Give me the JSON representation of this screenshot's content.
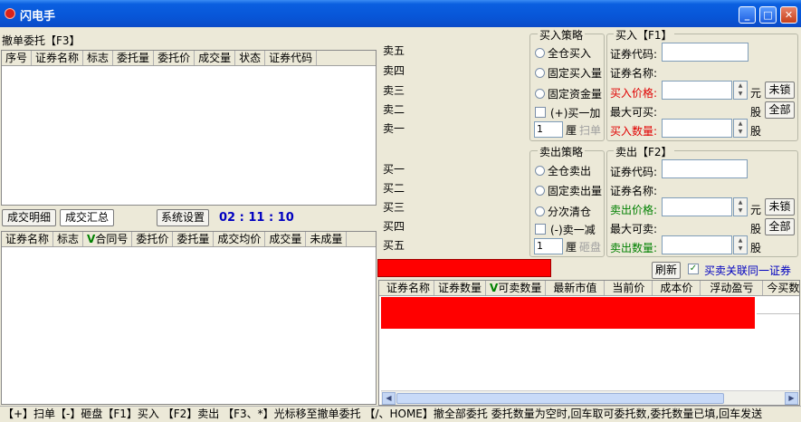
{
  "window": {
    "title": "闪电手"
  },
  "cancel_panel": {
    "title": "撤单委托【F3】",
    "columns": [
      "序号",
      "证券名称",
      "标志",
      "委托量",
      "委托价",
      "成交量",
      "状态",
      "证券代码"
    ]
  },
  "tabs": {
    "detail": "成交明细",
    "summary": "成交汇总"
  },
  "settings_button": "系统设置",
  "timer": "02 : 11 : 10",
  "fills_panel": {
    "columns_prefix": "证券名称",
    "col_flag": "标志",
    "col_contract_mark": "V",
    "col_contract": "合同号",
    "col_price": "委托价",
    "col_qty": "委托量",
    "col_avg": "成交均价",
    "col_filled": "成交量",
    "col_unfilled": "未成量"
  },
  "order_book": {
    "asks": [
      "卖五",
      "卖四",
      "卖三",
      "卖二",
      "卖一"
    ],
    "bids": [
      "买一",
      "买二",
      "买三",
      "买四",
      "买五"
    ]
  },
  "buy_strategy": {
    "title": "买入策略",
    "options": [
      "全仓买入",
      "固定买入量",
      "固定资金量"
    ],
    "add_label": "(+)买一加",
    "tick_value": "1",
    "tick_unit": "厘",
    "sweep": "扫单"
  },
  "sell_strategy": {
    "title": "卖出策略",
    "options": [
      "全仓卖出",
      "固定卖出量",
      "分次清仓"
    ],
    "sub_label": "(-)卖一减",
    "tick_value": "1",
    "tick_unit": "厘",
    "smash": "砸盘"
  },
  "buy_form": {
    "title": "买入【F1】",
    "code_label": "证券代码:",
    "name_label": "证券名称:",
    "price_label": "买入价格:",
    "price_unit": "元",
    "price_btn": "未锁",
    "max_label": "最大可买:",
    "max_unit": "股",
    "max_btn": "全部",
    "qty_label": "买入数量:",
    "qty_unit": "股"
  },
  "sell_form": {
    "title": "卖出【F2】",
    "code_label": "证券代码:",
    "name_label": "证券名称:",
    "price_label": "卖出价格:",
    "price_unit": "元",
    "price_btn": "未锁",
    "max_label": "最大可卖:",
    "max_unit": "股",
    "max_btn": "全部",
    "qty_label": "卖出数量:",
    "qty_unit": "股"
  },
  "refresh_button": "刷新",
  "link_checkbox": "买卖关联同一证券",
  "positions": {
    "col_name": "证券名称",
    "col_qty": "证券数量",
    "col_sellable_mark": "V",
    "col_sellable": "可卖数量",
    "col_mkt_value": "最新市值",
    "col_price": "当前价",
    "col_cost": "成本价",
    "col_pnl": "浮动盈亏",
    "col_more": "今买数量"
  },
  "status_bar": "【+】扫单【-】砸盘【F1】买入 【F2】卖出 【F3、*】光标移至撤单委托 【/、HOME】撤全部委托 委托数量为空时,回车取可委托数,委托数量已填,回车发送",
  "colors": {
    "title_bar": "#0a5fe0",
    "highlight": "#ff0000",
    "timer": "#0000c0"
  },
  "icons": [
    "app-icon",
    "minimize-icon",
    "maximize-icon",
    "close-icon",
    "scroll-left-icon",
    "scroll-right-icon"
  ]
}
